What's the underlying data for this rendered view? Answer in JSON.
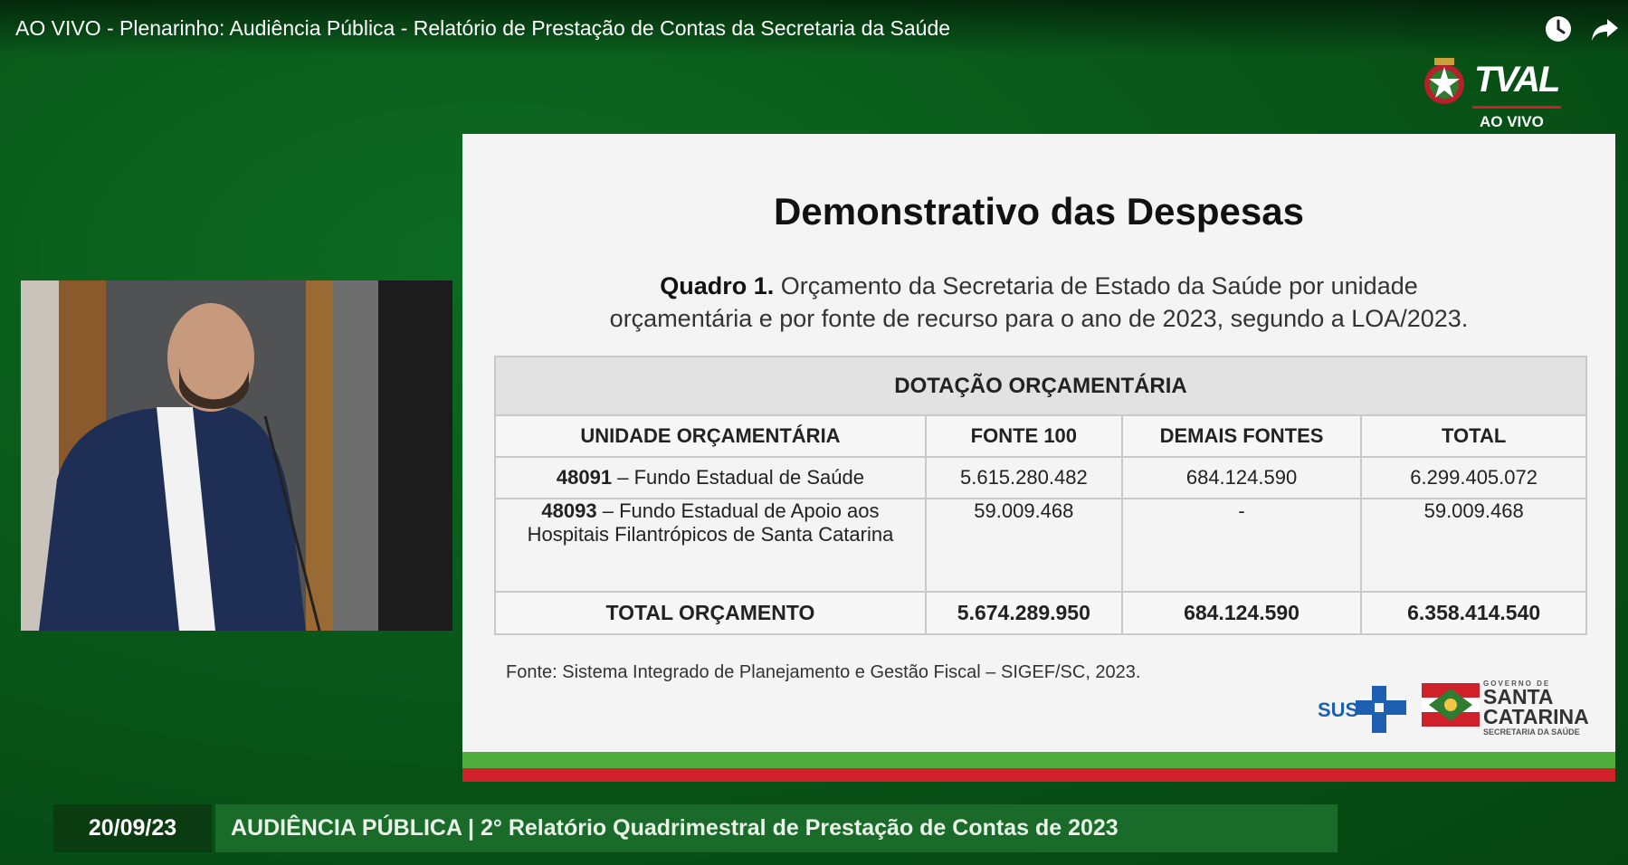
{
  "video": {
    "title": "AO VIVO - Plenarinho: Audiência Pública - Relatório de Prestação de Contas da Secretaria da Saúde"
  },
  "toolbar": {
    "icons": [
      "clock-icon",
      "share-icon"
    ]
  },
  "channel_logo": {
    "name": "TVAL",
    "status": "AO VIVO"
  },
  "slide": {
    "title": "Demonstrativo das Despesas",
    "caption_bold": "Quadro 1.",
    "caption_line1": " Orçamento da Secretaria de Estado da Saúde por unidade",
    "caption_line2": "orçamentária e por fonte de recurso para o ano de 2023, segundo a LOA/2023.",
    "table": {
      "group_header": "DOTAÇÃO ORÇAMENTÁRIA",
      "columns": [
        "UNIDADE ORÇAMENTÁRIA",
        "FONTE 100",
        "DEMAIS FONTES",
        "TOTAL"
      ],
      "rows": [
        {
          "code": "48091",
          "name": " – Fundo Estadual de Saúde",
          "fonte100": "5.615.280.482",
          "demais": "684.124.590",
          "total": "6.299.405.072"
        },
        {
          "code": "48093",
          "name": " – Fundo Estadual de Apoio aos Hospitais Filantrópicos de Santa Catarina",
          "fonte100": "59.009.468",
          "demais": "-",
          "total": "59.009.468"
        }
      ],
      "total_row": {
        "label": "TOTAL ORÇAMENTO",
        "fonte100": "5.674.289.950",
        "demais": "684.124.590",
        "total": "6.358.414.540"
      }
    },
    "source": "Fonte: Sistema Integrado de Planejamento e Gestão Fiscal – SIGEF/SC, 2023.",
    "logos": {
      "sus": "SUS",
      "sc_gov": "GOVERNO DE",
      "sc_name_1": "SANTA",
      "sc_name_2": "CATARINA",
      "sc_sec": "SECRETARIA DA SAÚDE"
    },
    "colors": {
      "stripe_green": "#4fad3b",
      "stripe_red": "#d0212a"
    }
  },
  "lower_third": {
    "date": "20/09/23",
    "text": "AUDIÊNCIA PÚBLICA | 2° Relatório Quadrimestral de Prestação de Contas de 2023"
  }
}
